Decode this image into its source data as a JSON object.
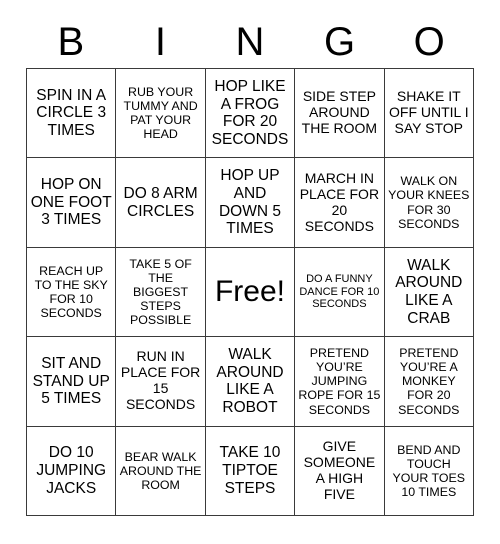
{
  "header": {
    "letters": [
      "B",
      "I",
      "N",
      "G",
      "O"
    ]
  },
  "grid": {
    "columns": 5,
    "rows": 5,
    "cells": [
      {
        "text": "SPIN IN A CIRCLE 3 TIMES",
        "size": "s-lg",
        "free": false
      },
      {
        "text": "RUB YOUR TUMMY AND PAT YOUR HEAD",
        "size": "s-sm",
        "free": false
      },
      {
        "text": "HOP LIKE A FROG FOR 20 SECONDS",
        "size": "s-lg",
        "free": false
      },
      {
        "text": "SIDE STEP AROUND THE ROOM",
        "size": "s-md",
        "free": false
      },
      {
        "text": "SHAKE IT OFF UNTIL I SAY STOP",
        "size": "s-md",
        "free": false
      },
      {
        "text": "HOP ON ONE FOOT 3 TIMES",
        "size": "s-lg",
        "free": false
      },
      {
        "text": "DO 8 ARM CIRCLES",
        "size": "s-lg",
        "free": false
      },
      {
        "text": "HOP UP AND DOWN 5 TIMES",
        "size": "s-lg",
        "free": false
      },
      {
        "text": "MARCH IN PLACE FOR 20 SECONDS",
        "size": "s-md",
        "free": false
      },
      {
        "text": "WALK ON YOUR KNEES FOR 30 SECONDS",
        "size": "s-sm",
        "free": false
      },
      {
        "text": "REACH UP TO THE SKY FOR 10 SECONDS",
        "size": "s-sm",
        "free": false
      },
      {
        "text": "TAKE 5 OF THE BIGGEST STEPS POSSIBLE",
        "size": "s-sm",
        "free": false
      },
      {
        "text": "Free!",
        "size": "s-xl",
        "free": true
      },
      {
        "text": "DO A FUNNY DANCE FOR 10 SECONDS",
        "size": "s-xs",
        "free": false
      },
      {
        "text": "WALK AROUND LIKE A CRAB",
        "size": "s-lg",
        "free": false
      },
      {
        "text": "SIT AND STAND UP 5 TIMES",
        "size": "s-lg",
        "free": false
      },
      {
        "text": "RUN IN PLACE FOR 15 SECONDS",
        "size": "s-md",
        "free": false
      },
      {
        "text": "WALK AROUND LIKE A ROBOT",
        "size": "s-lg",
        "free": false
      },
      {
        "text": "PRETEND YOU’RE JUMPING ROPE FOR 15 SECONDS",
        "size": "s-sm",
        "free": false
      },
      {
        "text": "PRETEND YOU’RE A MONKEY FOR 20 SECONDS",
        "size": "s-sm",
        "free": false
      },
      {
        "text": "DO 10 JUMPING JACKS",
        "size": "s-lg",
        "free": false
      },
      {
        "text": "BEAR WALK AROUND THE ROOM",
        "size": "s-sm",
        "free": false
      },
      {
        "text": "TAKE 10 TIPTOE STEPS",
        "size": "s-lg",
        "free": false
      },
      {
        "text": "GIVE SOMEONE A HIGH FIVE",
        "size": "s-md",
        "free": false
      },
      {
        "text": "BEND AND TOUCH YOUR TOES 10 TIMES",
        "size": "s-sm",
        "free": false
      }
    ]
  },
  "colors": {
    "background": "#ffffff",
    "text": "#000000",
    "border": "#3a3a3a"
  }
}
